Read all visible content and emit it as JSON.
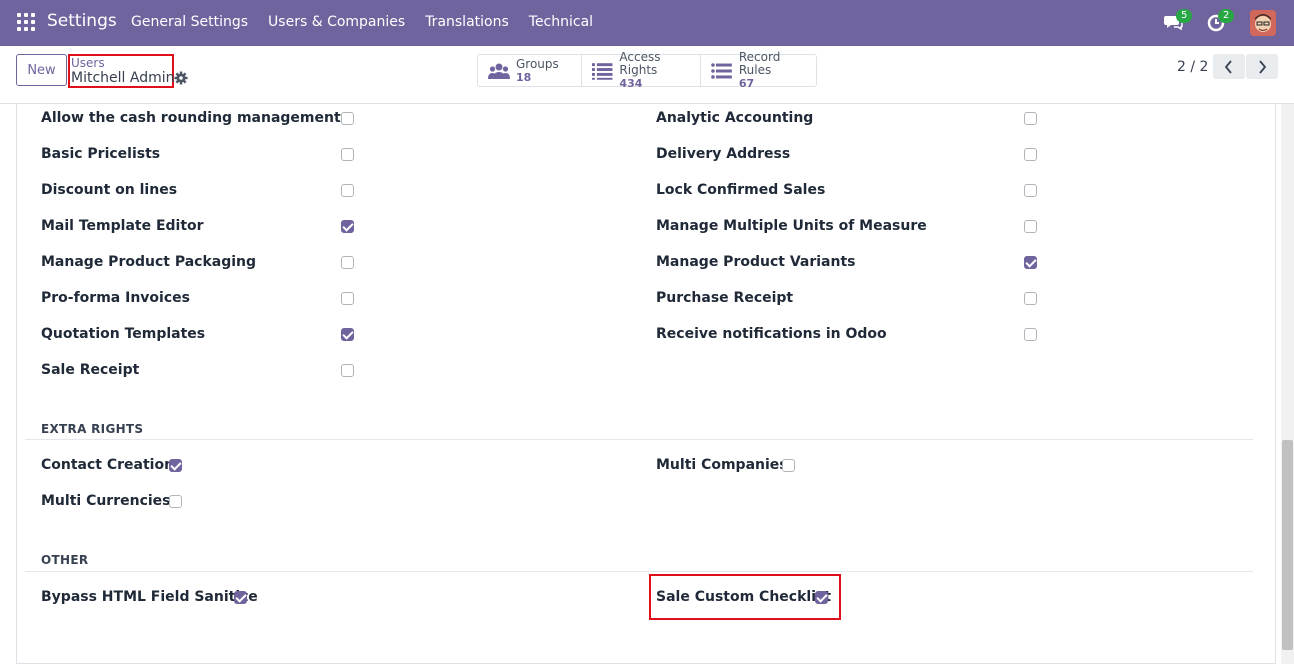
{
  "navbar": {
    "brand": "Settings",
    "menu": [
      "General Settings",
      "Users & Companies",
      "Translations",
      "Technical"
    ],
    "messages_count": "5",
    "activities_count": "2"
  },
  "control": {
    "new_label": "New",
    "breadcrumb_parent": "Users",
    "breadcrumb_current": "Mitchell Admin",
    "smart_buttons": [
      {
        "label": "Groups",
        "value": "18",
        "icon": "users-icon"
      },
      {
        "label": "Access Rights",
        "value": "434",
        "icon": "list-icon"
      },
      {
        "label": "Record Rules",
        "value": "67",
        "icon": "list-icon"
      }
    ],
    "pager": "2 / 2"
  },
  "groups": {
    "left": [
      {
        "label": "Allow the cash rounding management",
        "checked": false
      },
      {
        "label": "Basic Pricelists",
        "checked": false
      },
      {
        "label": "Discount on lines",
        "checked": false
      },
      {
        "label": "Mail Template Editor",
        "checked": true
      },
      {
        "label": "Manage Product Packaging",
        "checked": false
      },
      {
        "label": "Pro-forma Invoices",
        "checked": false
      },
      {
        "label": "Quotation Templates",
        "checked": true
      },
      {
        "label": "Sale Receipt",
        "checked": false
      }
    ],
    "right": [
      {
        "label": "Analytic Accounting",
        "checked": false
      },
      {
        "label": "Delivery Address",
        "checked": false
      },
      {
        "label": "Lock Confirmed Sales",
        "checked": false
      },
      {
        "label": "Manage Multiple Units of Measure",
        "checked": false
      },
      {
        "label": "Manage Product Variants",
        "checked": true
      },
      {
        "label": "Purchase Receipt",
        "checked": false
      },
      {
        "label": "Receive notifications in Odoo",
        "checked": false
      }
    ]
  },
  "extra_rights": {
    "title": "EXTRA RIGHTS",
    "items": [
      {
        "label": "Contact Creation",
        "checked": true
      },
      {
        "label": "Multi Companies",
        "checked": false
      },
      {
        "label": "Multi Currencies",
        "checked": false
      }
    ]
  },
  "other": {
    "title": "OTHER",
    "items": [
      {
        "label": "Bypass HTML Field Sanitize",
        "checked": true
      },
      {
        "label": "Sale Custom Checklist",
        "checked": true
      }
    ]
  },
  "colors": {
    "navbar": "#71639e",
    "accent": "#71639e",
    "highlight": "#e0101a"
  }
}
